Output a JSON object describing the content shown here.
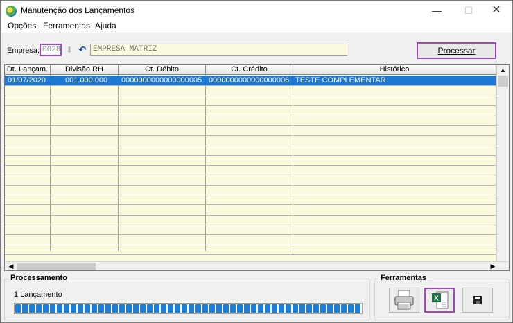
{
  "window": {
    "title": "Manutenção dos Lançamentos",
    "controls": {
      "minimize": "—",
      "maximize": "☐",
      "close": "✕"
    }
  },
  "menu": [
    "Opções",
    "Ferramentas",
    "Ajuda"
  ],
  "empresa": {
    "label": "Empresa:",
    "code": "0028",
    "name": "EMPRESA MATRIZ"
  },
  "process_button": "Processar",
  "grid": {
    "columns": [
      "Dt. Lançam.",
      "Divisão RH",
      "Ct. Débito",
      "Ct. Crédito",
      "Histórico"
    ],
    "rows": [
      [
        "01/07/2020",
        "001.000.000",
        "0000000000000000005",
        "0000000000000000006",
        "TESTE COMPLEMENTAR"
      ]
    ]
  },
  "processamento": {
    "label": "Processamento",
    "status": "1 Lançamento",
    "progress": 1.0
  },
  "ferramentas": {
    "label": "Ferramentas",
    "tools": [
      "printer-icon",
      "excel-export-icon",
      "save-disk-icon"
    ]
  },
  "colors": {
    "selection": "#1d78d4",
    "grid_bg": "#fdfbdf",
    "highlight": "#9c4bbc",
    "progress": "#1a7fd8"
  }
}
